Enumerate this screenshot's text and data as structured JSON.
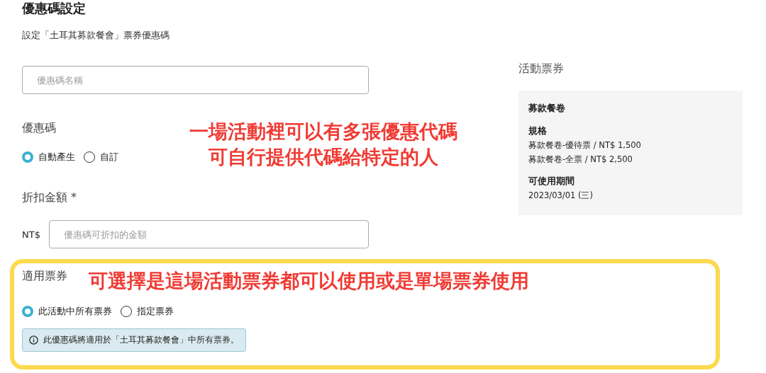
{
  "page": {
    "title": "優惠碼設定",
    "subtitle": "設定「土耳其募款餐會」票券優惠碼"
  },
  "name_field": {
    "placeholder": "優惠碼名稱"
  },
  "code_section": {
    "label": "優惠碼",
    "options": [
      {
        "label": "自動產生",
        "selected": true
      },
      {
        "label": "自訂",
        "selected": false
      }
    ]
  },
  "discount_section": {
    "label": "折扣金額 *",
    "currency": "NT$",
    "placeholder": "優惠碼可折扣的金額"
  },
  "ticket_section": {
    "label": "適用票券",
    "options": [
      {
        "label": "此活動中所有票券",
        "selected": true
      },
      {
        "label": "指定票券",
        "selected": false
      }
    ],
    "info": "此優惠碼將適用於「土耳其募款餐會」中所有票券。"
  },
  "event_tickets": {
    "heading": "活動票券",
    "card": {
      "name": "募款餐卷",
      "spec_label": "規格",
      "specs": [
        "募款餐卷-優待票 / NT$ 1,500",
        "募款餐卷-全票 / NT$ 2,500"
      ],
      "period_label": "可使用期間",
      "period": "2023/03/01 (三)"
    }
  },
  "annotations": {
    "top": [
      "一場活動裡可以有多張優惠代碼",
      "可自行提供代碼給特定的人"
    ],
    "tickets": "可選擇是這場活動票券都可以使用或是單場票券使用"
  }
}
